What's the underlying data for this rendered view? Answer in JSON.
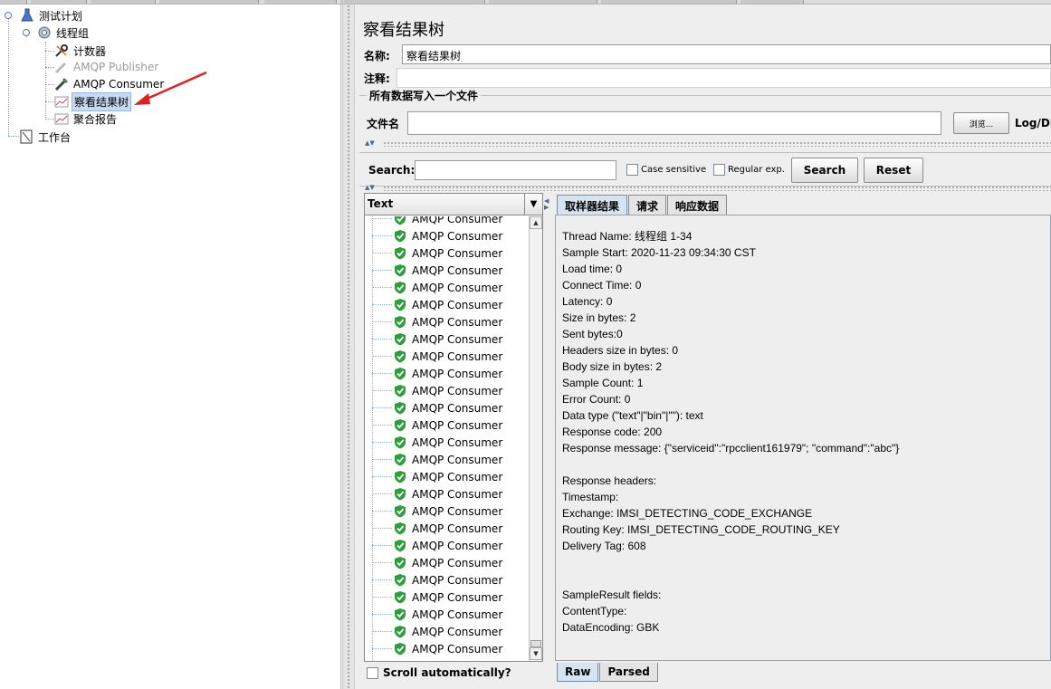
{
  "tree": {
    "root": "测试计划",
    "thread_group": "线程组",
    "children": [
      "计数器",
      "AMQP Publisher",
      "AMQP Consumer",
      "察看结果树",
      "聚合报告"
    ],
    "workbench": "工作台"
  },
  "panel": {
    "title": "察看结果树",
    "name_label": "名称:",
    "name_value": "察看结果树",
    "comment_label": "注释:",
    "comment_value": "",
    "file_group_title": "所有数据写入一个文件",
    "file_label": "文件名",
    "file_value": "",
    "browse_label": "浏览...",
    "log_label": "Log/Dis"
  },
  "search": {
    "label": "Search:",
    "value": "",
    "case_sensitive": "Case sensitive",
    "regular_exp": "Regular exp.",
    "search_button": "Search",
    "reset_button": "Reset"
  },
  "result_list": {
    "renderer": "Text",
    "items": [
      "AMQP Consumer",
      "AMQP Consumer",
      "AMQP Consumer",
      "AMQP Consumer",
      "AMQP Consumer",
      "AMQP Consumer",
      "AMQP Consumer",
      "AMQP Consumer",
      "AMQP Consumer",
      "AMQP Consumer",
      "AMQP Consumer",
      "AMQP Consumer",
      "AMQP Consumer",
      "AMQP Consumer",
      "AMQP Consumer",
      "AMQP Consumer",
      "AMQP Consumer",
      "AMQP Consumer",
      "AMQP Consumer",
      "AMQP Consumer",
      "AMQP Consumer",
      "AMQP Consumer",
      "AMQP Consumer",
      "AMQP Consumer",
      "AMQP Consumer",
      "AMQP Consumer"
    ],
    "scroll_auto": "Scroll automatically?"
  },
  "detail": {
    "tabs": [
      "取样器结果",
      "请求",
      "响应数据"
    ],
    "lines": [
      "Thread Name: 线程组 1-34",
      "Sample Start: 2020-11-23 09:34:30 CST",
      "Load time: 0",
      "Connect Time: 0",
      "Latency: 0",
      "Size in bytes: 2",
      "Sent bytes:0",
      "Headers size in bytes: 0",
      "Body size in bytes: 2",
      "Sample Count: 1",
      "Error Count: 0",
      "Data type (\"text\"|\"bin\"|\"\"): text",
      "Response code: 200",
      "Response message: {\"serviceid\":\"rpcclient161979\"; \"command\":\"abc\"}",
      "",
      "Response headers:",
      "Timestamp:",
      "Exchange: IMSI_DETECTING_CODE_EXCHANGE",
      "Routing Key: IMSI_DETECTING_CODE_ROUTING_KEY",
      "Delivery Tag: 608",
      "",
      "",
      "SampleResult fields:",
      "ContentType:",
      "DataEncoding: GBK"
    ],
    "bottom_tabs": [
      "Raw",
      "Parsed"
    ]
  },
  "colors": {
    "selection": "#c6daf0",
    "shield_green": "#2e9e3a",
    "arrow_red": "#e02020"
  }
}
